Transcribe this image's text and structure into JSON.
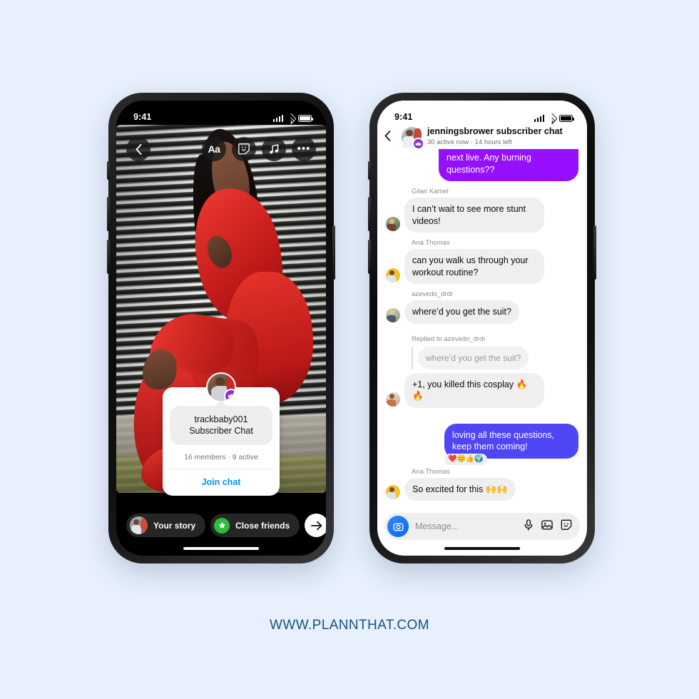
{
  "page": {
    "background_color": "#e7f0fc",
    "footer_text": "WWW.PLANNTHAT.COM",
    "footer_color": "#16537e"
  },
  "phone_story": {
    "status_bar": {
      "time": "9:41",
      "signal_icon": "cellular-bars-icon",
      "wifi_icon": "wifi-icon",
      "battery_icon": "battery-icon"
    },
    "toolbar": {
      "back_label": "‹",
      "text_tool_label": "Aa",
      "sticker_tool_icon": "sticker-smiley-icon",
      "music_tool_icon": "music-note-icon",
      "more_tool_label": "•••"
    },
    "subscriber_card": {
      "username": "trackbaby001",
      "subtitle": "Subscriber Chat",
      "meta": "16 members · 9 active",
      "join_label": "Join chat",
      "join_color": "#0095f6",
      "badge_icon": "crown-badge-icon",
      "badge_color": "#8b2fe0"
    },
    "bottom_bar": {
      "your_story_label": "Your story",
      "close_friends_label": "Close friends",
      "close_friends_color": "#2fbd3c",
      "send_icon": "arrow-right-icon"
    }
  },
  "phone_chat": {
    "status_bar": {
      "time": "9:41",
      "signal_icon": "cellular-bars-icon",
      "wifi_icon": "wifi-icon",
      "battery_icon": "battery-icon"
    },
    "header": {
      "back_icon": "chevron-left-icon",
      "title": "jenningsbrower subscriber chat",
      "subtitle": "30 active now · 14 hours left",
      "badge_icon": "crown-badge-icon"
    },
    "messages": [
      {
        "id": "m0",
        "type": "outgoing-purple",
        "text": "next live. Any burning questions??",
        "color": "#9610ff"
      },
      {
        "id": "m1",
        "type": "incoming",
        "sender": "Gilan Kamel",
        "text": "I can’t wait to see more stunt videos!",
        "avatar": "av-a"
      },
      {
        "id": "m2",
        "type": "incoming",
        "sender": "Ana Thomas",
        "text": "can you walk us through your workout routine?",
        "avatar": "av-b"
      },
      {
        "id": "m3",
        "type": "incoming",
        "sender": "azevedo_drdr",
        "text": "where’d you get the suit?",
        "avatar": "av-c"
      },
      {
        "id": "m4",
        "type": "reply",
        "reply_label": "Replied to azevedo_drdr",
        "quoted_text": "where’d you get the suit?",
        "text": "+1, you killed this cosplay 🔥🔥",
        "avatar": "av-d"
      },
      {
        "id": "m5",
        "type": "outgoing",
        "text": "loving all these questions, keep them coming!",
        "color": "#4f46f5",
        "reactions": "❤️😊👍🌍"
      },
      {
        "id": "m6",
        "type": "incoming",
        "sender": "Ana Thomas",
        "text": "So excited for this 🙌🙌",
        "avatar": "av-b"
      }
    ],
    "input_bar": {
      "camera_icon": "camera-icon",
      "placeholder": "Message...",
      "mic_icon": "microphone-icon",
      "gallery_icon": "image-icon",
      "sticker_icon": "sticker-smiley-icon"
    }
  }
}
